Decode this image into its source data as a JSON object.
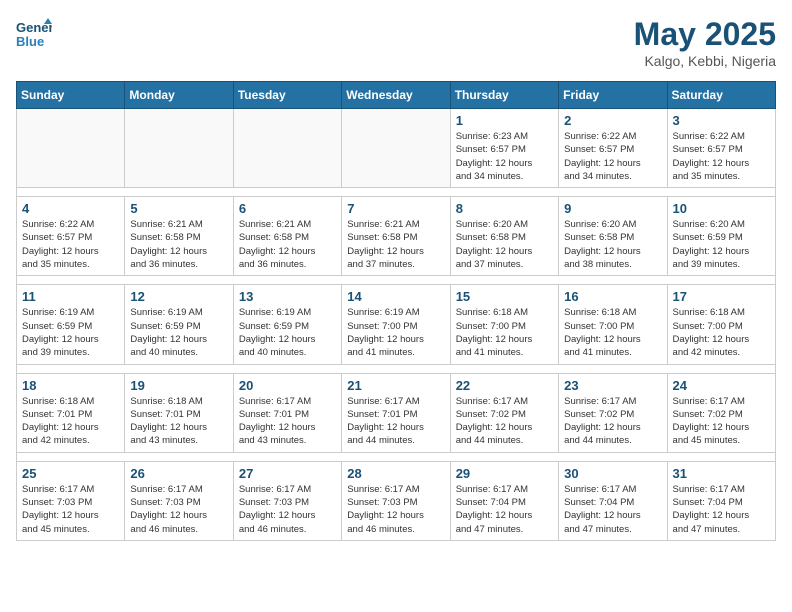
{
  "header": {
    "logo_line1": "General",
    "logo_line2": "Blue",
    "month": "May 2025",
    "location": "Kalgo, Kebbi, Nigeria"
  },
  "weekdays": [
    "Sunday",
    "Monday",
    "Tuesday",
    "Wednesday",
    "Thursday",
    "Friday",
    "Saturday"
  ],
  "weeks": [
    [
      {
        "day": "",
        "info": ""
      },
      {
        "day": "",
        "info": ""
      },
      {
        "day": "",
        "info": ""
      },
      {
        "day": "",
        "info": ""
      },
      {
        "day": "1",
        "info": "Sunrise: 6:23 AM\nSunset: 6:57 PM\nDaylight: 12 hours\nand 34 minutes."
      },
      {
        "day": "2",
        "info": "Sunrise: 6:22 AM\nSunset: 6:57 PM\nDaylight: 12 hours\nand 34 minutes."
      },
      {
        "day": "3",
        "info": "Sunrise: 6:22 AM\nSunset: 6:57 PM\nDaylight: 12 hours\nand 35 minutes."
      }
    ],
    [
      {
        "day": "4",
        "info": "Sunrise: 6:22 AM\nSunset: 6:57 PM\nDaylight: 12 hours\nand 35 minutes."
      },
      {
        "day": "5",
        "info": "Sunrise: 6:21 AM\nSunset: 6:58 PM\nDaylight: 12 hours\nand 36 minutes."
      },
      {
        "day": "6",
        "info": "Sunrise: 6:21 AM\nSunset: 6:58 PM\nDaylight: 12 hours\nand 36 minutes."
      },
      {
        "day": "7",
        "info": "Sunrise: 6:21 AM\nSunset: 6:58 PM\nDaylight: 12 hours\nand 37 minutes."
      },
      {
        "day": "8",
        "info": "Sunrise: 6:20 AM\nSunset: 6:58 PM\nDaylight: 12 hours\nand 37 minutes."
      },
      {
        "day": "9",
        "info": "Sunrise: 6:20 AM\nSunset: 6:58 PM\nDaylight: 12 hours\nand 38 minutes."
      },
      {
        "day": "10",
        "info": "Sunrise: 6:20 AM\nSunset: 6:59 PM\nDaylight: 12 hours\nand 39 minutes."
      }
    ],
    [
      {
        "day": "11",
        "info": "Sunrise: 6:19 AM\nSunset: 6:59 PM\nDaylight: 12 hours\nand 39 minutes."
      },
      {
        "day": "12",
        "info": "Sunrise: 6:19 AM\nSunset: 6:59 PM\nDaylight: 12 hours\nand 40 minutes."
      },
      {
        "day": "13",
        "info": "Sunrise: 6:19 AM\nSunset: 6:59 PM\nDaylight: 12 hours\nand 40 minutes."
      },
      {
        "day": "14",
        "info": "Sunrise: 6:19 AM\nSunset: 7:00 PM\nDaylight: 12 hours\nand 41 minutes."
      },
      {
        "day": "15",
        "info": "Sunrise: 6:18 AM\nSunset: 7:00 PM\nDaylight: 12 hours\nand 41 minutes."
      },
      {
        "day": "16",
        "info": "Sunrise: 6:18 AM\nSunset: 7:00 PM\nDaylight: 12 hours\nand 41 minutes."
      },
      {
        "day": "17",
        "info": "Sunrise: 6:18 AM\nSunset: 7:00 PM\nDaylight: 12 hours\nand 42 minutes."
      }
    ],
    [
      {
        "day": "18",
        "info": "Sunrise: 6:18 AM\nSunset: 7:01 PM\nDaylight: 12 hours\nand 42 minutes."
      },
      {
        "day": "19",
        "info": "Sunrise: 6:18 AM\nSunset: 7:01 PM\nDaylight: 12 hours\nand 43 minutes."
      },
      {
        "day": "20",
        "info": "Sunrise: 6:17 AM\nSunset: 7:01 PM\nDaylight: 12 hours\nand 43 minutes."
      },
      {
        "day": "21",
        "info": "Sunrise: 6:17 AM\nSunset: 7:01 PM\nDaylight: 12 hours\nand 44 minutes."
      },
      {
        "day": "22",
        "info": "Sunrise: 6:17 AM\nSunset: 7:02 PM\nDaylight: 12 hours\nand 44 minutes."
      },
      {
        "day": "23",
        "info": "Sunrise: 6:17 AM\nSunset: 7:02 PM\nDaylight: 12 hours\nand 44 minutes."
      },
      {
        "day": "24",
        "info": "Sunrise: 6:17 AM\nSunset: 7:02 PM\nDaylight: 12 hours\nand 45 minutes."
      }
    ],
    [
      {
        "day": "25",
        "info": "Sunrise: 6:17 AM\nSunset: 7:03 PM\nDaylight: 12 hours\nand 45 minutes."
      },
      {
        "day": "26",
        "info": "Sunrise: 6:17 AM\nSunset: 7:03 PM\nDaylight: 12 hours\nand 46 minutes."
      },
      {
        "day": "27",
        "info": "Sunrise: 6:17 AM\nSunset: 7:03 PM\nDaylight: 12 hours\nand 46 minutes."
      },
      {
        "day": "28",
        "info": "Sunrise: 6:17 AM\nSunset: 7:03 PM\nDaylight: 12 hours\nand 46 minutes."
      },
      {
        "day": "29",
        "info": "Sunrise: 6:17 AM\nSunset: 7:04 PM\nDaylight: 12 hours\nand 47 minutes."
      },
      {
        "day": "30",
        "info": "Sunrise: 6:17 AM\nSunset: 7:04 PM\nDaylight: 12 hours\nand 47 minutes."
      },
      {
        "day": "31",
        "info": "Sunrise: 6:17 AM\nSunset: 7:04 PM\nDaylight: 12 hours\nand 47 minutes."
      }
    ]
  ]
}
